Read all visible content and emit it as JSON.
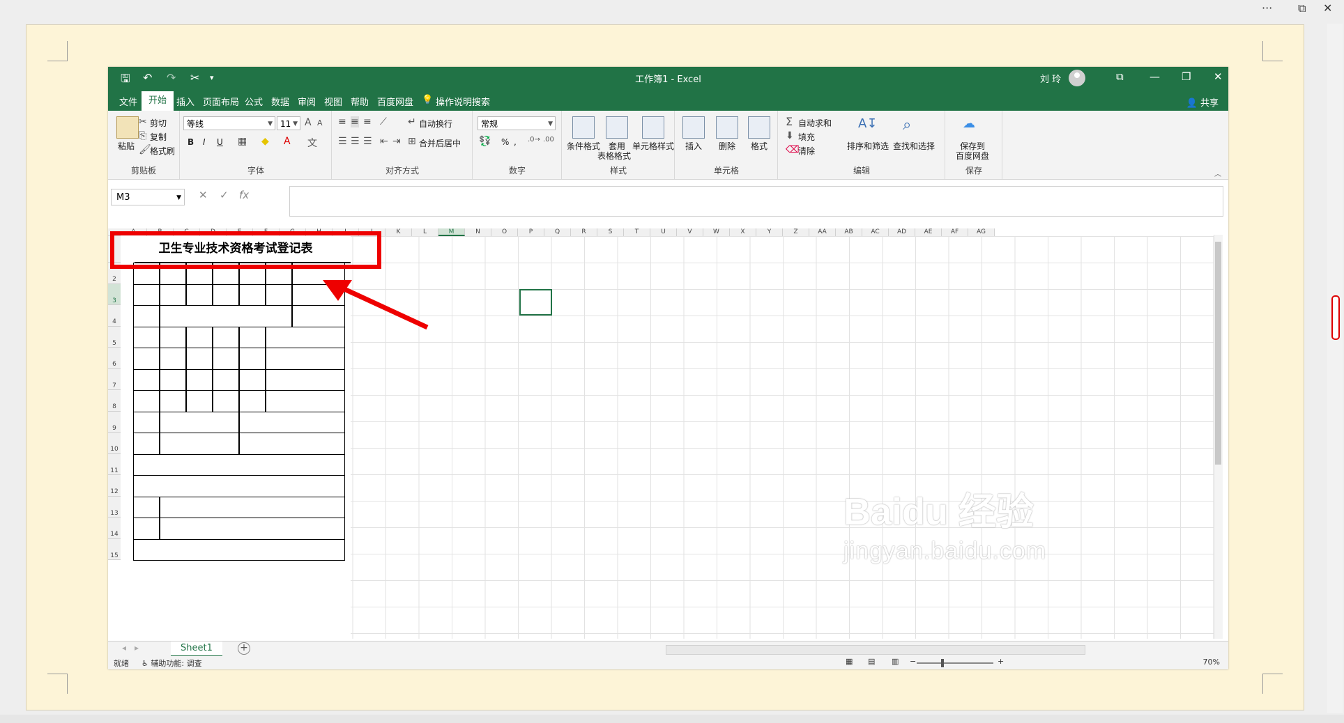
{
  "outer": {
    "more_label": "···",
    "close_label": "✕"
  },
  "title_bar": {
    "title": "工作簿1  -  Excel",
    "user": "刘 玲"
  },
  "tabs": [
    {
      "label": "文件"
    },
    {
      "label": "开始"
    },
    {
      "label": "插入"
    },
    {
      "label": "页面布局"
    },
    {
      "label": "公式"
    },
    {
      "label": "数据"
    },
    {
      "label": "审阅"
    },
    {
      "label": "视图"
    },
    {
      "label": "帮助"
    },
    {
      "label": "百度网盘"
    },
    {
      "label": "操作说明搜索"
    }
  ],
  "share_label": "共享",
  "ribbon": {
    "clipboard": {
      "paste": "粘贴",
      "cut": "剪切",
      "copy": "复制",
      "format_painter": "格式刷",
      "label": "剪贴板"
    },
    "font": {
      "name": "等线",
      "size": "11",
      "bold": "B",
      "italic": "I",
      "underline": "U",
      "label": "字体"
    },
    "alignment": {
      "wrap": "自动换行",
      "merge": "合并后居中",
      "label": "对齐方式"
    },
    "number": {
      "format": "常规",
      "percent": "%",
      "comma": ",",
      "label": "数字"
    },
    "styles": {
      "cond": "条件格式",
      "table": "套用",
      "table2": "表格格式",
      "cell": "单元格样式",
      "label": "样式"
    },
    "cells": {
      "insert": "插入",
      "delete": "删除",
      "format": "格式",
      "label": "单元格"
    },
    "editing": {
      "autosum": "自动求和",
      "fill": "填充",
      "clear": "清除",
      "sort": "排序和筛选",
      "find": "查找和选择",
      "label": "编辑"
    },
    "save": {
      "line1": "保存到",
      "line2": "百度网盘",
      "label": "保存"
    }
  },
  "formula_bar": {
    "name_box": "M3",
    "fx": "fx",
    "value": ""
  },
  "columns": [
    "A",
    "B",
    "C",
    "D",
    "E",
    "F",
    "G",
    "H",
    "I",
    "J",
    "K",
    "L",
    "M",
    "N",
    "O",
    "P",
    "Q",
    "R",
    "S",
    "T",
    "U",
    "V",
    "W",
    "X",
    "Y",
    "Z",
    "AA",
    "AB",
    "AC",
    "AD",
    "AE",
    "AF",
    "AG"
  ],
  "rows": [
    "2",
    "3",
    "4",
    "5",
    "6",
    "7",
    "8",
    "9",
    "10",
    "11",
    "12",
    "13",
    "14",
    "15"
  ],
  "selected_cell": "M3",
  "form_title": "卫生专业技术资格考试登记表",
  "sheet_tab": "Sheet1",
  "status": {
    "ready": "就绪",
    "accessibility": "辅助功能: 调查",
    "zoom": "70%"
  },
  "watermark": {
    "logo": "Baidu 经验",
    "url": "jingyan.baidu.com"
  },
  "colors": {
    "excel_green": "#217346",
    "highlight_red": "#ee0000",
    "page_bg": "#fdf4d7"
  }
}
